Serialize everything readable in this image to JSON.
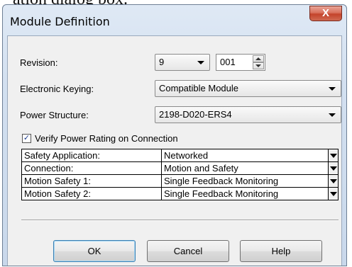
{
  "background": {
    "partial_text": "ation dialog box."
  },
  "dialog": {
    "title": "Module Definition",
    "close_label": "X",
    "revision": {
      "label": "Revision:",
      "major": "9",
      "minor": "001"
    },
    "electronic_keying": {
      "label": "Electronic Keying:",
      "value": "Compatible Module"
    },
    "power_structure": {
      "label": "Power Structure:",
      "value": "2198-D020-ERS4"
    },
    "verify_power": {
      "label": "Verify Power Rating on Connection",
      "checked": true,
      "check_glyph": "✓"
    },
    "properties": [
      {
        "name": "Safety Application:",
        "value": "Networked"
      },
      {
        "name": "Connection:",
        "value": "Motion and Safety"
      },
      {
        "name": "Motion Safety 1:",
        "value": "Single Feedback Monitoring"
      },
      {
        "name": "Motion Safety 2:",
        "value": "Single Feedback Monitoring"
      }
    ],
    "buttons": {
      "ok": "OK",
      "cancel": "Cancel",
      "help": "Help"
    }
  },
  "colors": {
    "accent_check": "#1c3c8c",
    "close_button": "#c4432b",
    "default_button_border": "#3c7fb1"
  }
}
